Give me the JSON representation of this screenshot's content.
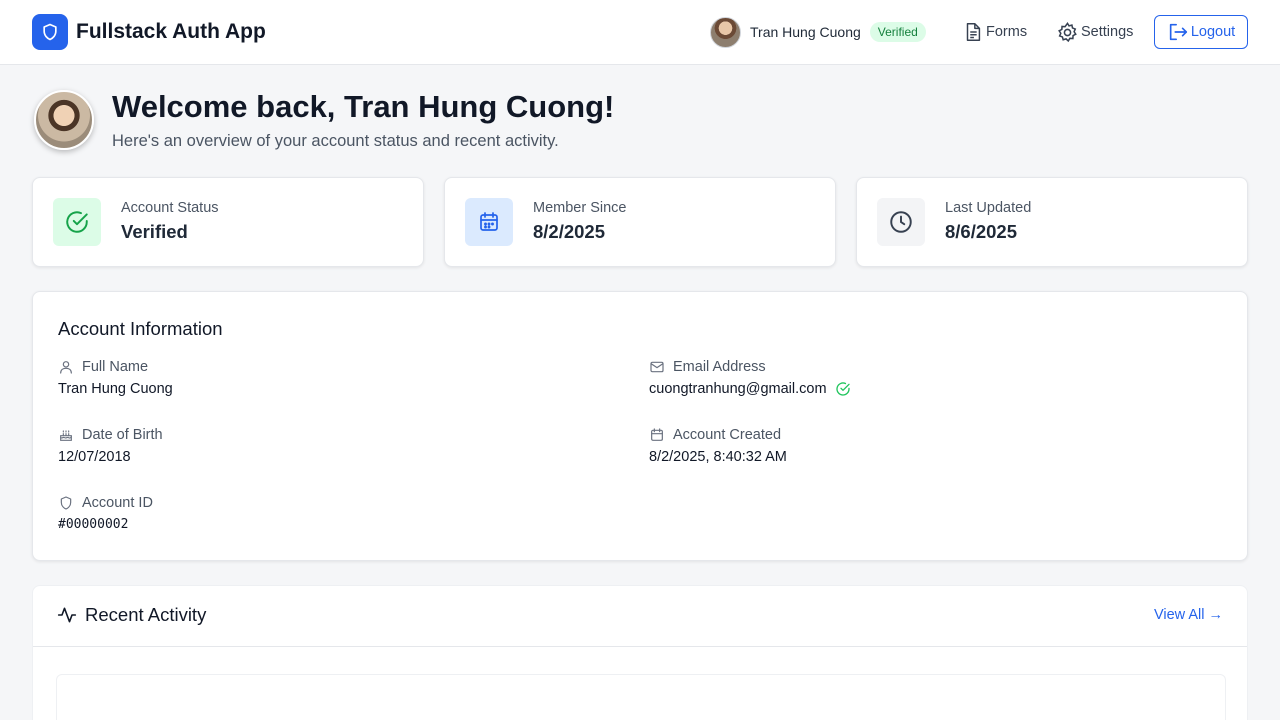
{
  "brand": {
    "title": "Fullstack Auth App",
    "icon": "shield-icon"
  },
  "nav": {
    "username": "Tran Hung Cuong",
    "badge": "Verified",
    "forms_label": "Forms",
    "settings_label": "Settings",
    "logout_label": "Logout"
  },
  "welcome": {
    "title": "Welcome back, Tran Hung Cuong!",
    "subtitle": "Here's an overview of your account status and recent activity."
  },
  "stats": [
    {
      "label": "Account Status",
      "value": "Verified",
      "icon": "check-circle-icon",
      "bg": "#dcfce7",
      "color": "#16a34a"
    },
    {
      "label": "Member Since",
      "value": "8/2/2025",
      "icon": "calendar-icon",
      "bg": "#dbeafe",
      "color": "#2563eb"
    },
    {
      "label": "Last Updated",
      "value": "8/6/2025",
      "icon": "clock-icon",
      "bg": "#f3f4f6",
      "color": "#374151"
    }
  ],
  "account_info": {
    "title": "Account Information",
    "full_name_label": "Full Name",
    "full_name": "Tran Hung Cuong",
    "email_label": "Email Address",
    "email": "cuongtranhung@gmail.com",
    "dob_label": "Date of Birth",
    "dob": "12/07/2018",
    "created_label": "Account Created",
    "created": "8/2/2025, 8:40:32 AM",
    "account_id_label": "Account ID",
    "account_id": "#00000002"
  },
  "activity": {
    "title": "Recent Activity",
    "view_all": "View All →"
  },
  "colors": {
    "accent": "#2563eb",
    "success": "#16a34a"
  }
}
